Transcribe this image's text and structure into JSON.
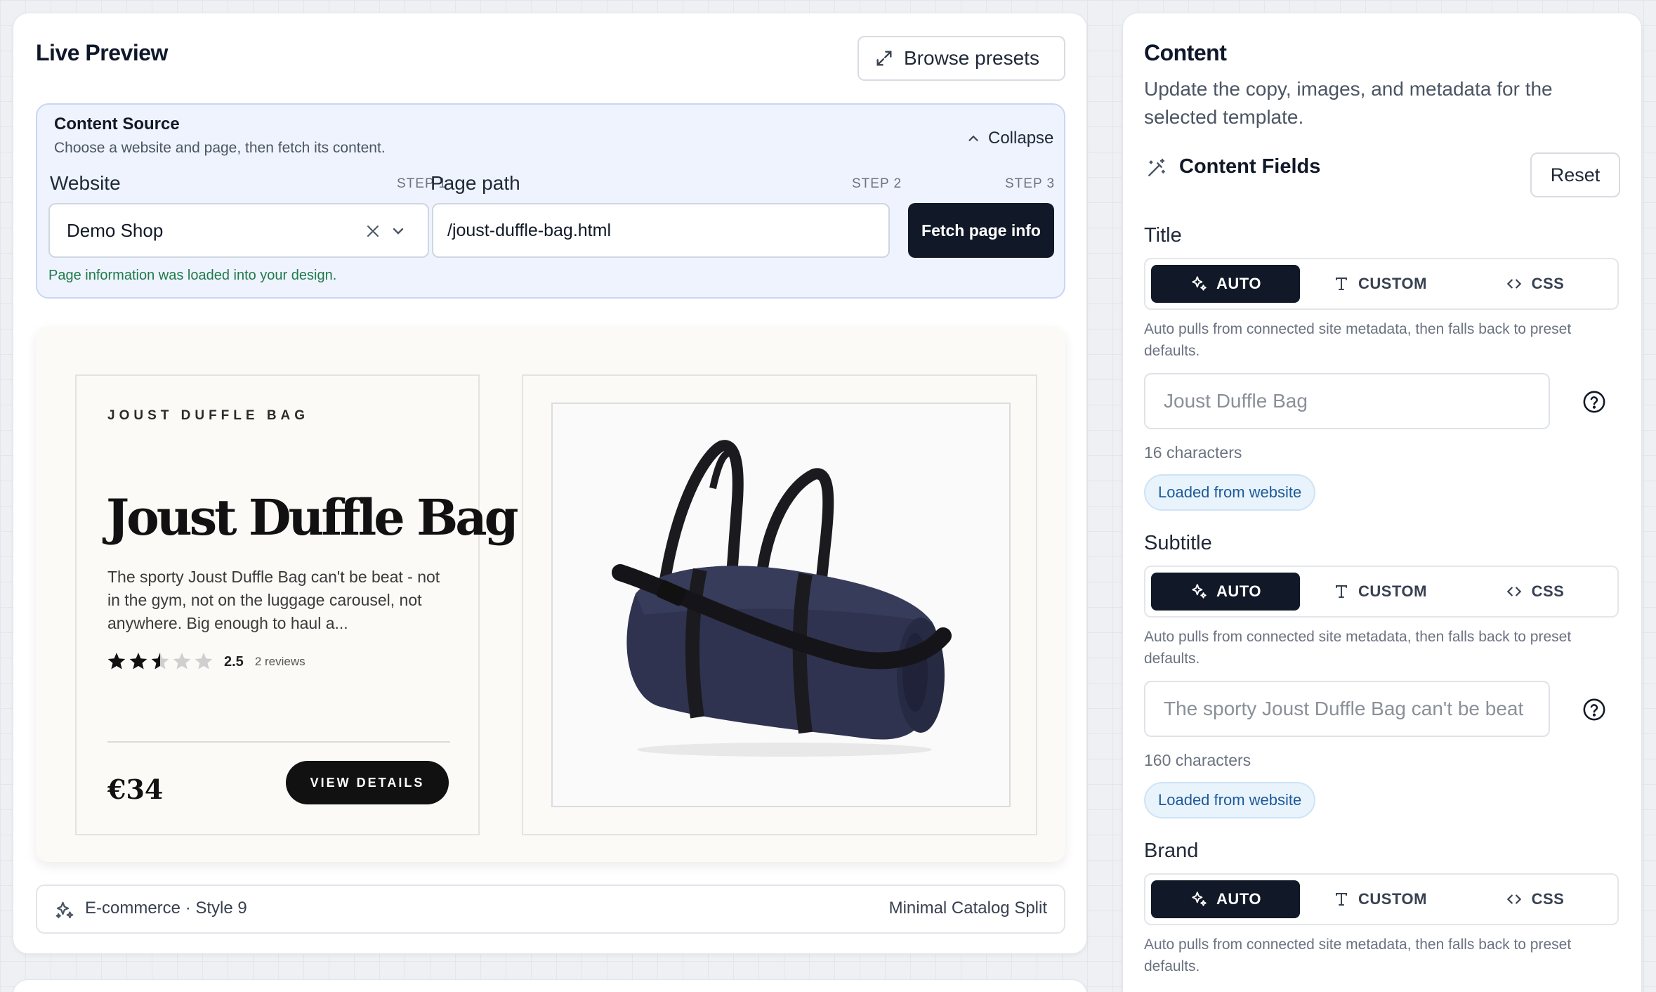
{
  "preview": {
    "title": "Live Preview",
    "browse_presets": "Browse presets",
    "source": {
      "title": "Content Source",
      "subtitle": "Choose a website and page, then fetch its content.",
      "collapse": "Collapse",
      "website_label": "Website",
      "website_step": "STEP 1",
      "website_value": "Demo Shop",
      "path_label": "Page path",
      "path_step": "STEP 2",
      "path_value": "/joust-duffle-bag.html",
      "fetch_step": "STEP 3",
      "fetch_button": "Fetch page info",
      "status": "Page information was loaded into your design."
    },
    "product": {
      "eyebrow": "JOUST DUFFLE BAG",
      "name": "Joust Duffle Bag",
      "description": "The sporty Joust Duffle Bag can't be beat - not in the gym, not on the luggage carousel, not anywhere. Big enough to haul a...",
      "rating": 2.5,
      "rating_text": "2.5",
      "reviews": "2 reviews",
      "price": "€34",
      "cta": "VIEW DETAILS"
    },
    "footer": {
      "category": "E-commerce · Style 9",
      "template": "Minimal Catalog Split"
    }
  },
  "content": {
    "title": "Content",
    "description": "Update the copy, images, and metadata for the selected template.",
    "fields_title": "Content Fields",
    "reset": "Reset",
    "modes": {
      "auto": "AUTO",
      "custom": "CUSTOM",
      "css": "CSS"
    },
    "fields": [
      {
        "label": "Title",
        "help": "Auto pulls from connected site metadata, then falls back to preset defaults.",
        "placeholder": "Joust Duffle Bag",
        "count": "16 characters",
        "badge": "Loaded from website"
      },
      {
        "label": "Subtitle",
        "help": "Auto pulls from connected site metadata, then falls back to preset defaults.",
        "placeholder": "The sporty Joust Duffle Bag can't be beat",
        "count": "160 characters",
        "badge": "Loaded from website"
      },
      {
        "label": "Brand",
        "help": "Auto pulls from connected site metadata, then falls back to preset defaults."
      }
    ]
  },
  "colors": {
    "primary": "#111827",
    "source_bg": "#eff3fe",
    "success_text": "#1f7a4a",
    "badge_bg": "#e8f3fc",
    "star": "#111111"
  }
}
